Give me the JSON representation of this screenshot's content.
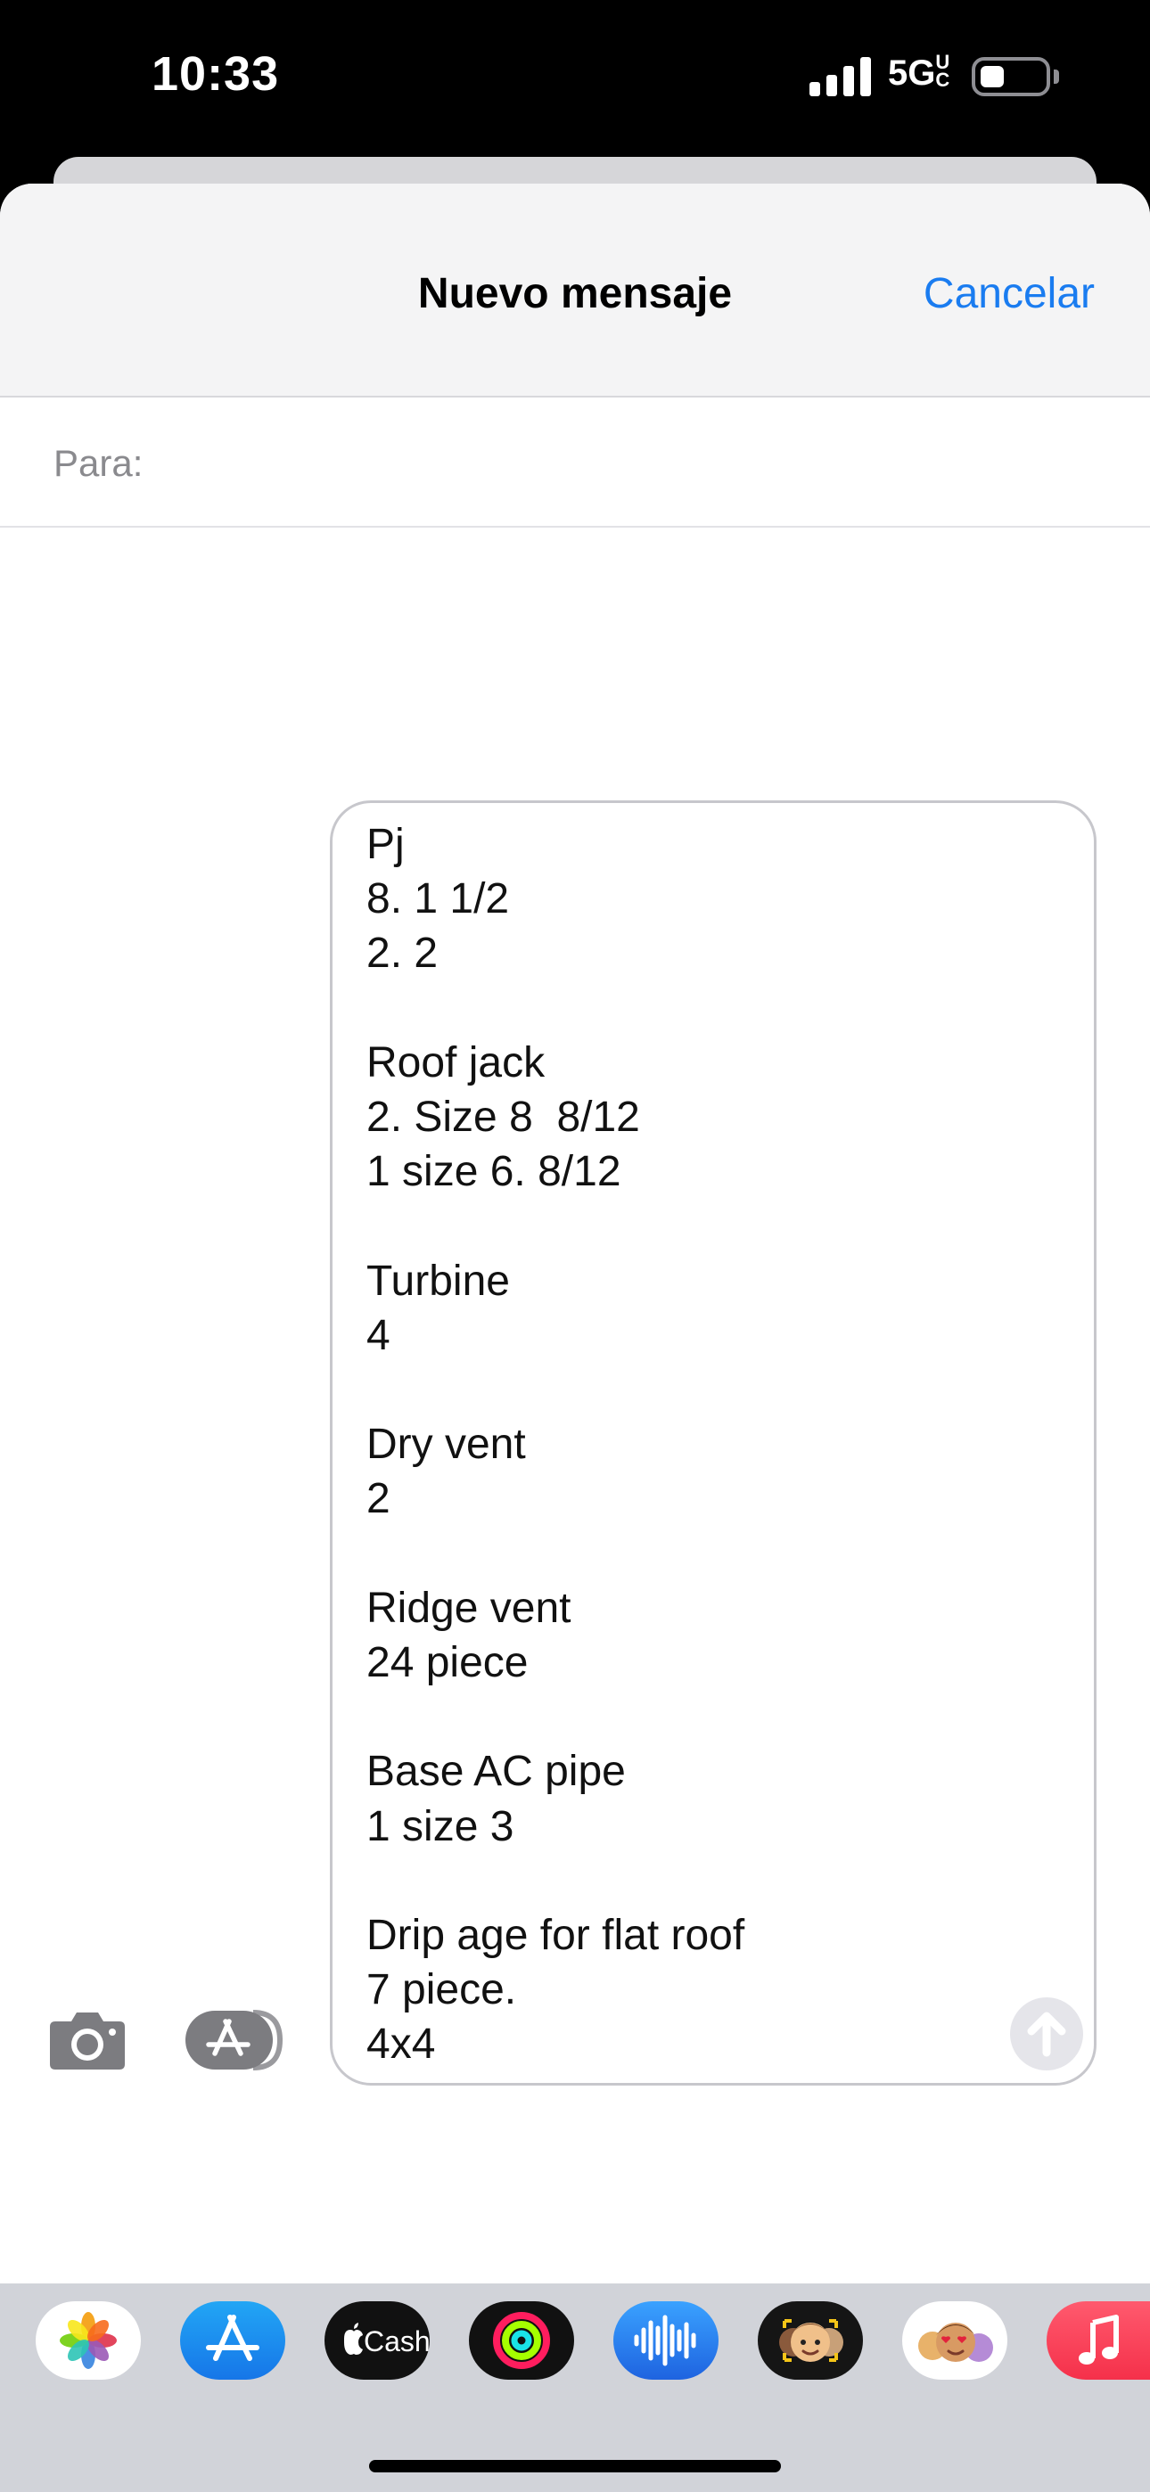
{
  "status": {
    "time": "10:33",
    "network": "5GUC",
    "battery_icon": "battery-low-icon"
  },
  "sheet": {
    "title": "Nuevo mensaje",
    "cancel_label": "Cancelar"
  },
  "recipient": {
    "label": "Para:"
  },
  "message": {
    "draft": "Pj\n8. 1 1/2\n2. 2\n\nRoof jack\n2. Size 8  8/12\n1 size 6. 8/12\n\nTurbine\n4\n\nDry vent\n2\n\nRidge vent\n24 piece\n\nBase AC pipe\n1 size 3\n\nDrip age for flat roof\n7 piece.\n4x4"
  },
  "apps": {
    "items": [
      "photos-icon",
      "app-store-icon",
      "apple-cash-icon",
      "activity-icon",
      "voice-memos-icon",
      "memoji-icon",
      "memoji-stickers-icon",
      "music-icon"
    ],
    "cash_label": "Cash"
  },
  "colors": {
    "accent": "#1a7cf0",
    "header_bg": "#f4f4f5",
    "strip_bg": "#d1d3d9"
  }
}
